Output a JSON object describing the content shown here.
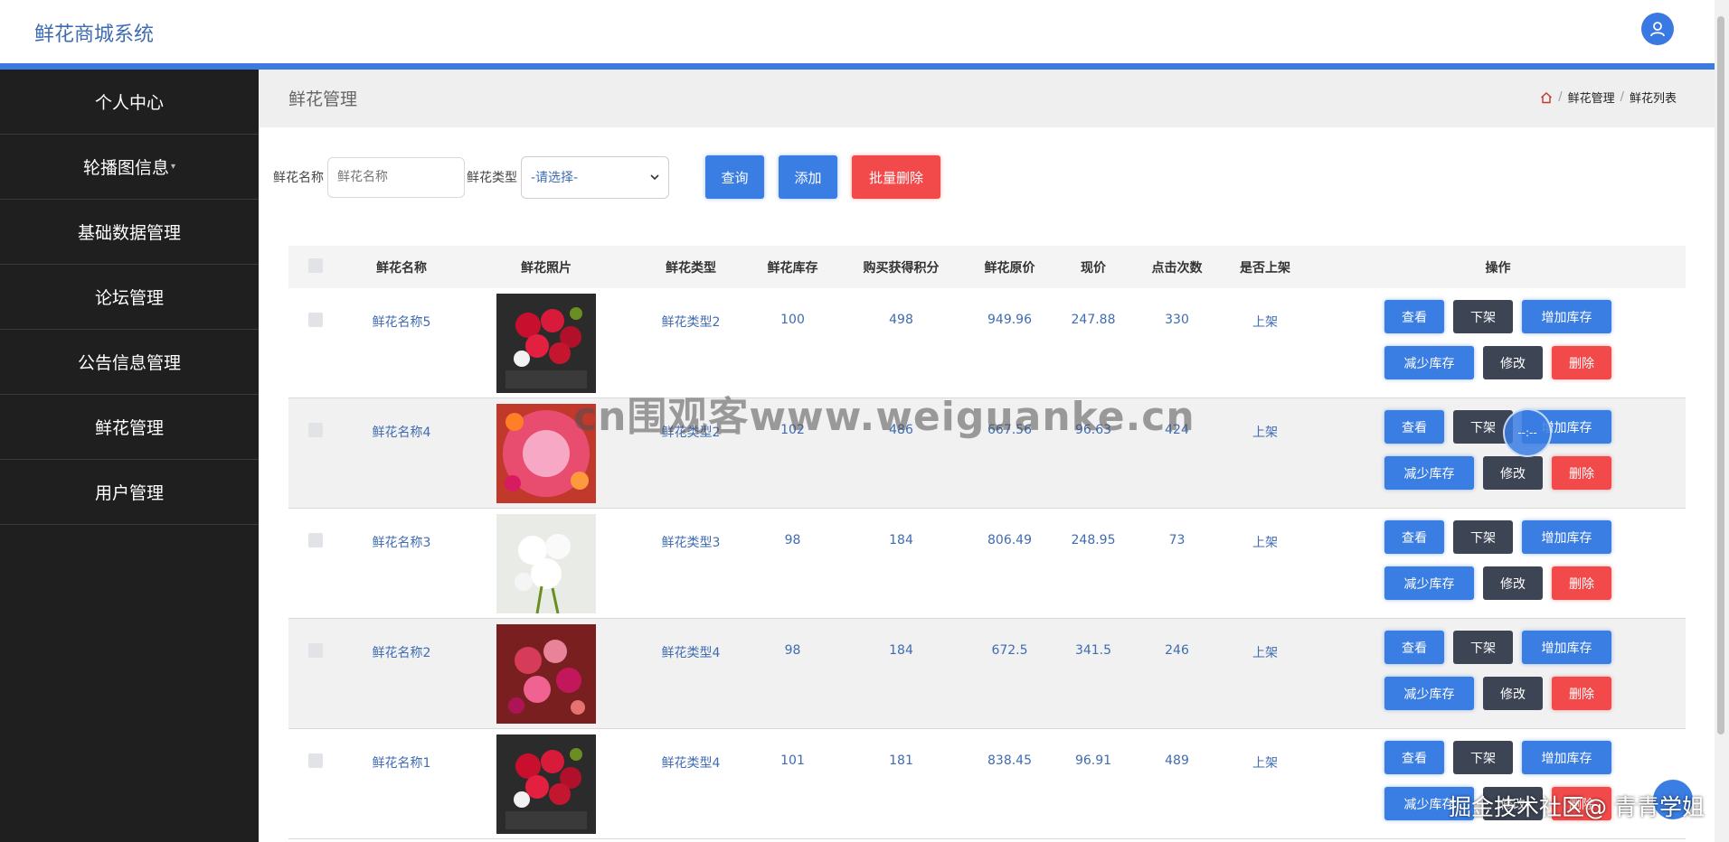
{
  "header": {
    "title": "鲜花商城系统"
  },
  "sidebar": {
    "items": [
      {
        "label": "个人中心",
        "caret": ""
      },
      {
        "label": "轮播图信息",
        "caret": "▾"
      },
      {
        "label": "基础数据管理",
        "caret": ""
      },
      {
        "label": "论坛管理",
        "caret": ""
      },
      {
        "label": "公告信息管理",
        "caret": ""
      },
      {
        "label": "鲜花管理",
        "caret": ""
      },
      {
        "label": "用户管理",
        "caret": ""
      }
    ]
  },
  "page": {
    "title": "鲜花管理",
    "breadcrumb": [
      "鲜花管理",
      "鲜花列表"
    ],
    "breadcrumb_sep": "/"
  },
  "filters": {
    "name_label": "鲜花名称",
    "name_placeholder": "鲜花名称",
    "type_label": "鲜花类型",
    "type_selected": "-请选择-",
    "query": "查询",
    "add": "添加",
    "batch_delete": "批量删除"
  },
  "table": {
    "columns": [
      "鲜花名称",
      "鲜花照片",
      "鲜花类型",
      "鲜花库存",
      "购买获得积分",
      "鲜花原价",
      "现价",
      "点击次数",
      "是否上架",
      "操作"
    ],
    "rows": [
      {
        "name": "鲜花名称5",
        "type": "鲜花类型2",
        "stock": "100",
        "points": "498",
        "orig": "949.96",
        "now": "247.88",
        "clicks": "330",
        "shelf": "上架",
        "photo": "red"
      },
      {
        "name": "鲜花名称4",
        "type": "鲜花类型2",
        "stock": "102",
        "points": "486",
        "orig": "667.56",
        "now": "96.63",
        "clicks": "424",
        "shelf": "上架",
        "photo": "pink"
      },
      {
        "name": "鲜花名称3",
        "type": "鲜花类型3",
        "stock": "98",
        "points": "184",
        "orig": "806.49",
        "now": "248.95",
        "clicks": "73",
        "shelf": "上架",
        "photo": "white"
      },
      {
        "name": "鲜花名称2",
        "type": "鲜花类型4",
        "stock": "98",
        "points": "184",
        "orig": "672.5",
        "now": "341.5",
        "clicks": "246",
        "shelf": "上架",
        "photo": "rose"
      },
      {
        "name": "鲜花名称1",
        "type": "鲜花类型4",
        "stock": "101",
        "points": "181",
        "orig": "838.45",
        "now": "96.91",
        "clicks": "489",
        "shelf": "上架",
        "photo": "red"
      }
    ],
    "actions": {
      "view": "查看",
      "down": "下架",
      "add_stock": "增加库存",
      "sub_stock": "减少库存",
      "edit": "修改",
      "delete": "删除"
    }
  },
  "overlays": {
    "watermark": "cn围观客www.weiguanke.cn",
    "float_circle": "--:--",
    "footer_mark": "掘金技术社区@ 青青学姐"
  },
  "colors": {
    "accent": "#3c7ae0",
    "sidebar": "#1f1f1f",
    "danger": "#f24a4a",
    "dark": "#3d4454",
    "link": "#3f6cb1"
  }
}
